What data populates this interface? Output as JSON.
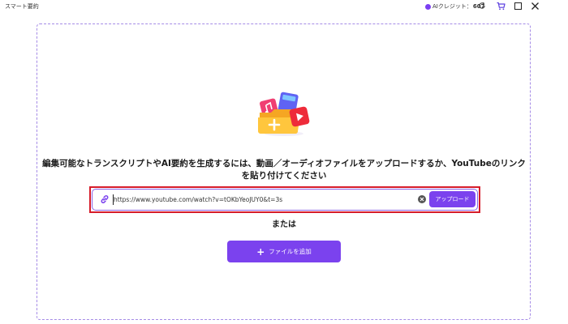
{
  "titlebar": {
    "app_title": "スマート要約",
    "credit_label": "AIクレジット：",
    "credit_value": "607"
  },
  "icons": {
    "refresh": "refresh-icon",
    "cart": "cart-icon",
    "maximize": "maximize-icon",
    "close": "close-icon",
    "link": "link-icon",
    "clear": "clear-icon",
    "plus": "plus-icon",
    "hero": "media-folder-illustration"
  },
  "main": {
    "instruction": "編集可能なトランスクリプトやAI要約を生成するには、動画／オーディオファイルをアップロードするか、YouTubeのリンクを貼り付けてください",
    "url_value": "https://www.youtube.com/watch?v=tOKbYeoJUY0&t=3s",
    "upload_label": "アップロード",
    "or_label": "または",
    "add_file_label": "ファイルを追加",
    "add_file_symbol": "+"
  },
  "colors": {
    "accent": "#7b42ee",
    "credit_dot": "#7b3ff2",
    "highlight_border": "#d61c2a",
    "dashed_border": "#a58be6"
  }
}
